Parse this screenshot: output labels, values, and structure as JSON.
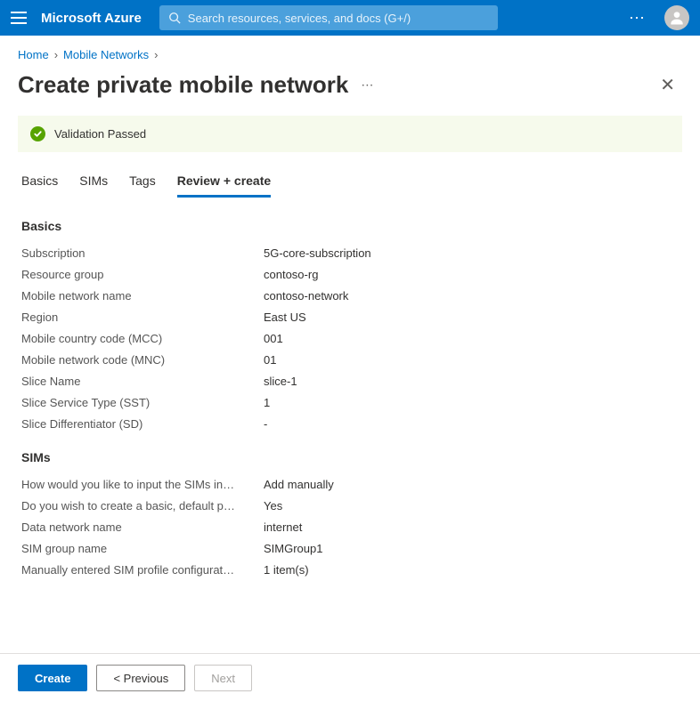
{
  "topbar": {
    "brand": "Microsoft Azure",
    "search_placeholder": "Search resources, services, and docs (G+/)"
  },
  "breadcrumb": {
    "items": [
      "Home",
      "Mobile Networks"
    ]
  },
  "page": {
    "title": "Create private mobile network"
  },
  "banner": {
    "text": "Validation Passed"
  },
  "tabs": [
    {
      "label": "Basics",
      "active": false
    },
    {
      "label": "SIMs",
      "active": false
    },
    {
      "label": "Tags",
      "active": false
    },
    {
      "label": "Review + create",
      "active": true
    }
  ],
  "sections": {
    "basics": {
      "title": "Basics",
      "rows": [
        {
          "label": "Subscription",
          "value": "5G-core-subscription"
        },
        {
          "label": "Resource group",
          "value": "contoso-rg"
        },
        {
          "label": "Mobile network name",
          "value": "contoso-network"
        },
        {
          "label": "Region",
          "value": "East US"
        },
        {
          "label": "Mobile country code (MCC)",
          "value": "001"
        },
        {
          "label": "Mobile network code (MNC)",
          "value": "01"
        },
        {
          "label": "Slice Name",
          "value": "slice-1"
        },
        {
          "label": "Slice Service Type (SST)",
          "value": "1"
        },
        {
          "label": "Slice Differentiator (SD)",
          "value": "-"
        }
      ]
    },
    "sims": {
      "title": "SIMs",
      "rows": [
        {
          "label": "How would you like to input the SIMs in…",
          "value": "Add manually"
        },
        {
          "label": "Do you wish to create a basic, default p…",
          "value": "Yes"
        },
        {
          "label": "Data network name",
          "value": "internet"
        },
        {
          "label": "SIM group name",
          "value": "SIMGroup1"
        },
        {
          "label": "Manually entered SIM profile configurat…",
          "value": "1 item(s)"
        }
      ]
    }
  },
  "footer": {
    "create": "Create",
    "previous": "< Previous",
    "next": "Next"
  }
}
